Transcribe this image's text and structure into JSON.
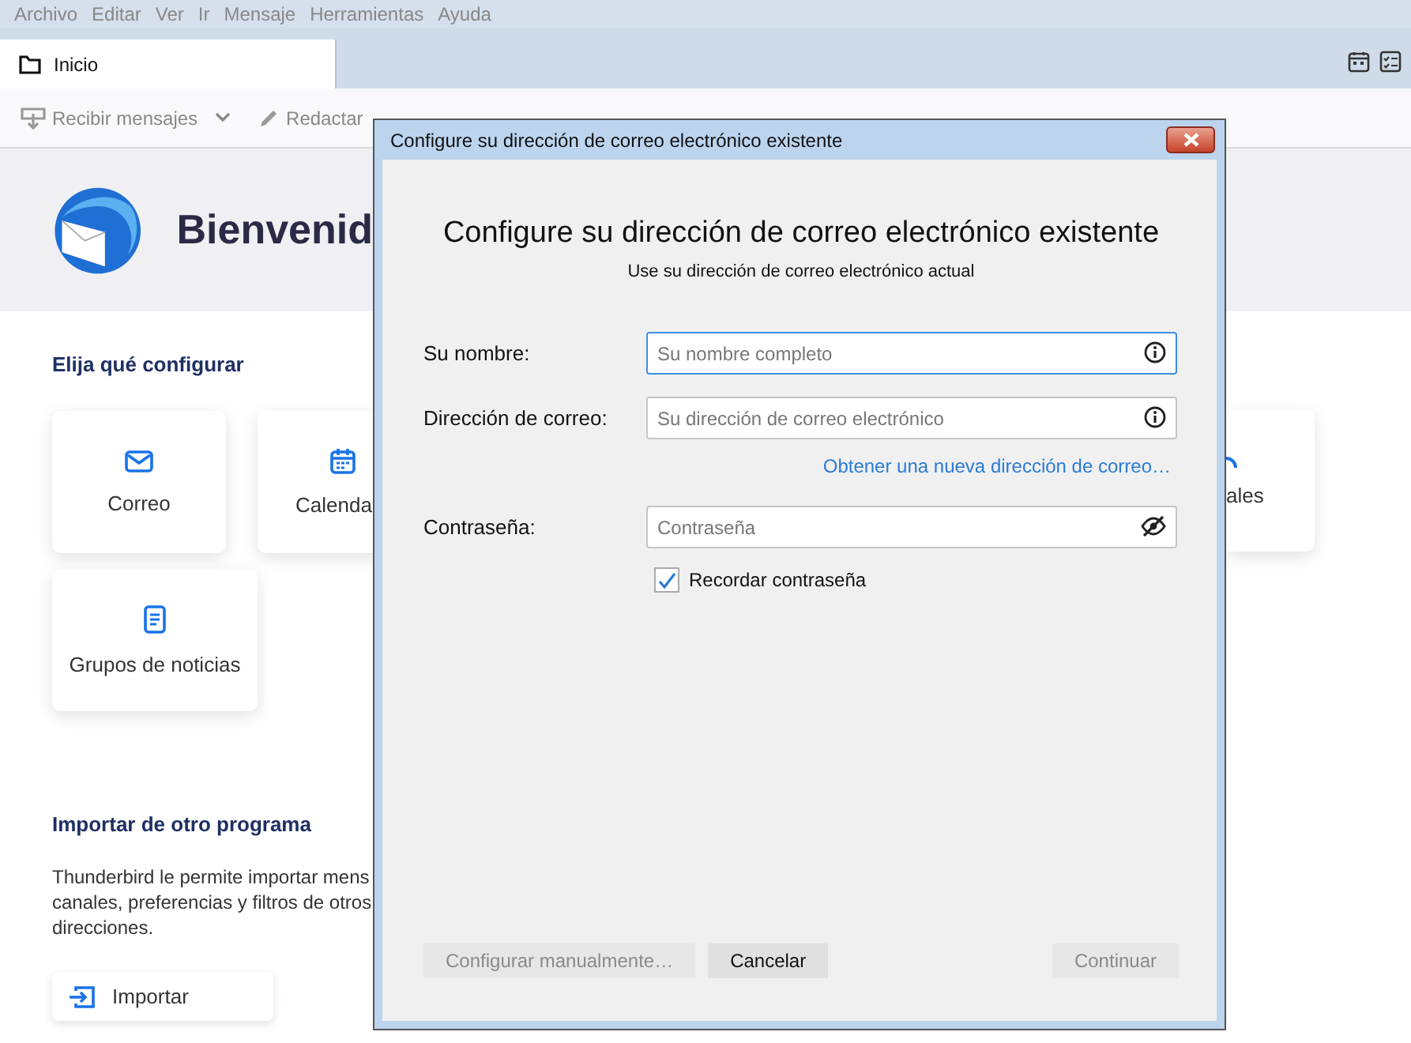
{
  "menu": [
    "Archivo",
    "Editar",
    "Ver",
    "Ir",
    "Mensaje",
    "Herramientas",
    "Ayuda"
  ],
  "tabs": [
    {
      "label": "Inicio",
      "selected": true
    }
  ],
  "toolbar": [
    {
      "label": "Recibir mensajes",
      "kind": "receive"
    },
    {
      "label": "Redactar",
      "kind": "compose"
    }
  ],
  "welcome": {
    "title": "Bienvenid",
    "setup_heading": "Elija qué configurar",
    "cards": [
      {
        "label": "Correo",
        "kind": "mail"
      },
      {
        "label": "Calenda",
        "kind": "calendar"
      },
      {
        "label": "Grupos de noticias",
        "kind": "news"
      }
    ],
    "right_card": {
      "label": "ales",
      "kind": "feed"
    },
    "import_heading": "Importar de otro programa",
    "import_text": [
      "Thunderbird le permite importar mens",
      "canales, preferencias y filtros de otros",
      "direcciones."
    ],
    "import_button": "Importar"
  },
  "dialog": {
    "title": "Configure su dirección de correo electrónico existente",
    "heading": "Configure su dirección de correo electrónico existente",
    "subtitle": "Use su dirección de correo electrónico actual",
    "fields": [
      {
        "label": "Su nombre:",
        "placeholder": "Su nombre completo",
        "kind": "info",
        "focused": true
      },
      {
        "label": "Dirección de correo:",
        "placeholder": "Su dirección de correo electrónico",
        "kind": "info",
        "focused": false
      },
      {
        "label": "Contraseña:",
        "placeholder": "Contraseña",
        "kind": "password",
        "focused": false
      }
    ],
    "link": "Obtener una nueva dirección de correo…",
    "remember": {
      "label": "Recordar contraseña",
      "checked": true
    },
    "buttons": [
      {
        "label": "Configurar manualmente…",
        "disabled": true,
        "kind": "left"
      },
      {
        "label": "Cancelar",
        "disabled": false,
        "kind": "left"
      },
      {
        "label": "Continuar",
        "disabled": true,
        "kind": "right"
      }
    ]
  }
}
